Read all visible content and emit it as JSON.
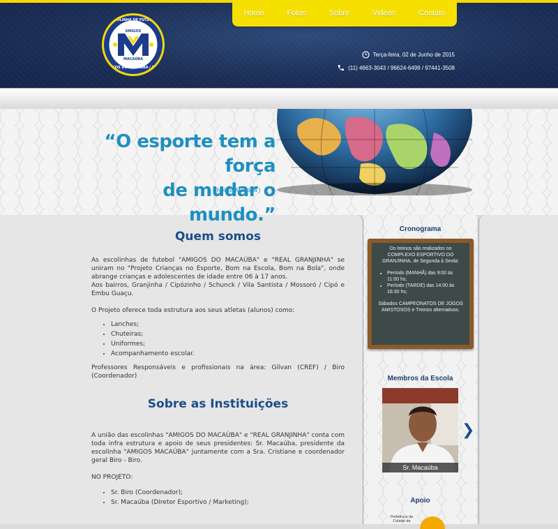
{
  "header": {
    "logo_text": {
      "top": "ESCOLINHA DE FUTEBOL",
      "amigos": "AMIGOS",
      "macauba": "MACAÚBA",
      "bottom": "AMIGOS DO MACAÚBA / REAL"
    },
    "nav": [
      "Home",
      "Fotos",
      "Sobre",
      "Videos",
      "Contato"
    ],
    "date": "Terça-feira, 02 de Junho de 2015",
    "phones": "(11) 4663-3043 / 96624-6499 / 97441-3508"
  },
  "banner": {
    "quote_line1": "“O esporte tem a força",
    "quote_line2": "de mudar o mundo.”",
    "author": "( Nelson Mandela )"
  },
  "main": {
    "quem_somos": {
      "title": "Quem somos",
      "p1": "As escolinhas de futebol \"AMIGOS DO MACAÚBA\" e \"REAL GRANJINHA\" se uniram no \"Projeto Crianças no Esporte, Bom na Escola, Bom na Bola\", onde abrange crianças e adolescentes de idade entre 06 à 17 anos.",
      "p2": "Aos bairros, Granjinha / Cipózinho / Schunck / Vila Santista / Mossoró / Cipó e Embu Guaçu.",
      "p3": "O Projeto oferece toda estrutura aos seus atletas (alunos) como:",
      "list": [
        "Lanches;",
        "Chuteiras;",
        "Uniformes;",
        "Acompanhamento escolar."
      ],
      "p4": "Professores Responsáveis e profissionais na área: Gilvan (CREF) / Biro (Coordenador)"
    },
    "sobre": {
      "title": "Sobre as Instituições",
      "p1": "A união das escolinhas \"AMIGOS DO MACAÚBA\" e \"REAL GRANJINHA\" conta com toda infra estrutura e apoio de seus presidentes: Sr. Macaúba, presidente da escolinha \"AMIGOS MACAÚBA\" juntamente com a Sra. Cristiane e coordenador geral Biro - Biro.",
      "p2": "NO PROJETO:",
      "list": [
        "Sr. Biro (Coordenador);",
        "Sr. Macaúba (Diretor Esportivo / Marketing);"
      ]
    }
  },
  "sidebar": {
    "cronograma_title": "Cronograma",
    "board": {
      "intro": "Os treinos são realizados no COMPLEXO ESPORTIVO DO GRANJINHA, de Segunda à Sexta:",
      "items": [
        "Período (MANHÃ) das 9:00 às 11:00 hs;",
        "Período (TARDE) das 14:00 às 16:30 hs;"
      ],
      "outro": "Sábados CAMPEONATOS DE JOGOS AMISTOSOS e Treinos alternativos."
    },
    "membros_title": "Membros da Escola",
    "member_name": "Sr. Macaúba",
    "apoio_title": "Apoio",
    "apoio_text": "Prefeitura da Cidade de"
  },
  "colors": {
    "accent": "#f5e000",
    "navy": "#1c2f57",
    "title_blue": "#1b4d8a",
    "quote_blue": "#1f8fc0"
  }
}
